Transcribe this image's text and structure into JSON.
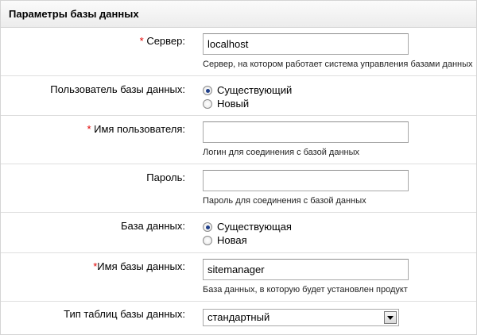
{
  "panel": {
    "title": "Параметры базы данных"
  },
  "server": {
    "required_mark": "* ",
    "label": "Сервер:",
    "value": "localhost",
    "hint": "Сервер, на котором работает система управления базами данных"
  },
  "db_user": {
    "label": "Пользователь базы данных:",
    "options": [
      {
        "label": "Существующий",
        "checked": true
      },
      {
        "label": "Новый",
        "checked": false
      }
    ]
  },
  "username": {
    "required_mark": "* ",
    "label": "Имя пользователя:",
    "value": "",
    "hint": "Логин для соединения с базой данных"
  },
  "password": {
    "label": "Пароль:",
    "value": "",
    "hint": "Пароль для соединения с базой данных"
  },
  "database": {
    "label": "База данных:",
    "options": [
      {
        "label": "Существующая",
        "checked": true
      },
      {
        "label": "Новая",
        "checked": false
      }
    ]
  },
  "db_name": {
    "required_mark": "*",
    "label": "Имя базы данных:",
    "value": "sitemanager",
    "hint": "База данных, в которую будет установлен продукт"
  },
  "table_type": {
    "label": "Тип таблиц базы данных:",
    "selected": "стандартный",
    "icon": "chevron-down-icon"
  },
  "colors": {
    "required": "#e00000",
    "radio_dot": "#1f3f8a"
  }
}
